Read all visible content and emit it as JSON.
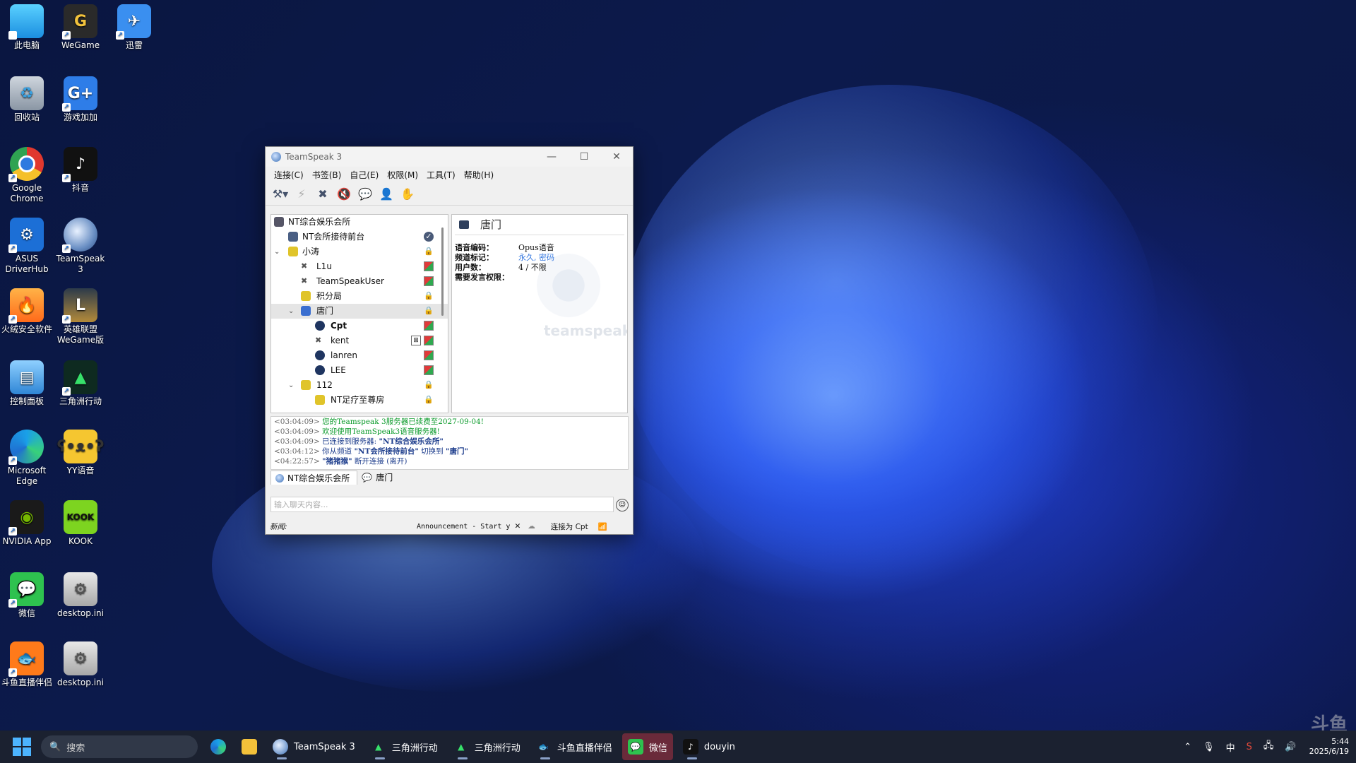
{
  "desktop": {
    "icons": [
      {
        "label": "此电脑"
      },
      {
        "label": "WeGame"
      },
      {
        "label": "迅雷"
      },
      {
        "label": "回收站"
      },
      {
        "label": "游戏加加"
      },
      {
        "label": "Google Chrome"
      },
      {
        "label": "抖音"
      },
      {
        "label": "ASUS DriverHub"
      },
      {
        "label": "TeamSpeak 3"
      },
      {
        "label": "火绒安全软件"
      },
      {
        "label": "英雄联盟WeGame版"
      },
      {
        "label": "控制面板"
      },
      {
        "label": "三角洲行动"
      },
      {
        "label": "Microsoft Edge"
      },
      {
        "label": "YY语音"
      },
      {
        "label": "NVIDIA App"
      },
      {
        "label": "KOOK"
      },
      {
        "label": "微信"
      },
      {
        "label": "desktop.ini"
      },
      {
        "label": "斗鱼直播伴侣"
      },
      {
        "label": "desktop.ini"
      }
    ]
  },
  "window": {
    "title": "TeamSpeak 3",
    "controls": {
      "minimize": "—",
      "maximize": "☐",
      "close": "✕"
    },
    "menu": [
      "连接(C)",
      "书签(B)",
      "自己(E)",
      "权限(M)",
      "工具(T)",
      "帮助(H)"
    ],
    "tree": {
      "server": "NT综合娱乐会所",
      "rows": [
        {
          "text": "NT会所接待前台"
        },
        {
          "text": "小涛"
        },
        {
          "text": "L1u"
        },
        {
          "text": "TeamSpeakUser"
        },
        {
          "text": "积分局"
        },
        {
          "text": "唐门"
        },
        {
          "text": "Cpt"
        },
        {
          "text": "kent"
        },
        {
          "text": "lanren"
        },
        {
          "text": "LEE"
        },
        {
          "text": "112"
        },
        {
          "text": "NT足疗至尊房"
        }
      ]
    },
    "info": {
      "channel": "唐门",
      "codec_label": "语音编码：",
      "codec_value": "Opus语音",
      "flags_label": "频道标记：",
      "flags_value": "永久, 密码",
      "users_label": "用户数：",
      "users_value": "4 / 不限",
      "talk_label": "需要发言权限：",
      "watermark": "teamspeak"
    },
    "log": [
      {
        "ts": "<03:04:09>",
        "msg": "您的Teamspeak 3服务器已续费至2027-09-04!"
      },
      {
        "ts": "<03:04:09>",
        "msg": "欢迎使用TeamSpeak3语音服务器!"
      },
      {
        "ts": "<03:04:09>",
        "pre": "已连接到服务器: ",
        "bold": "\"NT综合娱乐会所\""
      },
      {
        "ts": "<03:04:12>",
        "pre": "你从频道 ",
        "bold": "\"NT会所接待前台\"",
        "mid": " 切换到 ",
        "bold2": "\"唐门\""
      },
      {
        "ts": "<04:22:57>",
        "bold": "\"猪猪猴\"",
        "post": " 断开连接 (离开)"
      }
    ],
    "tabs": [
      "NT综合娱乐会所",
      "唐门"
    ],
    "chat_placeholder": "输入聊天内容...",
    "status": {
      "news": "新闻:",
      "announcement": "Announcement - Start y",
      "connected": "连接为 Cpt"
    }
  },
  "taskbar": {
    "search_placeholder": "搜索",
    "items": [
      {
        "label": "TeamSpeak 3"
      },
      {
        "label": "三角洲行动"
      },
      {
        "label": "三角洲行动"
      },
      {
        "label": "斗鱼直播伴侣"
      },
      {
        "label": "微信"
      },
      {
        "label": "douyin"
      }
    ],
    "tray": {
      "ime": "中",
      "time": "5:44",
      "date": "2025/6/19"
    }
  }
}
